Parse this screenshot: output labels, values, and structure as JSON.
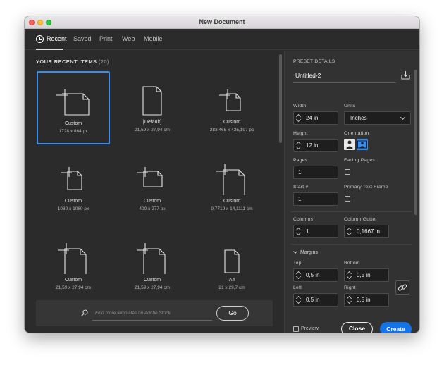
{
  "window": {
    "title": "New Document"
  },
  "tabs": [
    {
      "label": "Recent",
      "active": true
    },
    {
      "label": "Saved",
      "active": false
    },
    {
      "label": "Print",
      "active": false
    },
    {
      "label": "Web",
      "active": false
    },
    {
      "label": "Mobile",
      "active": false
    }
  ],
  "recent": {
    "heading": "YOUR RECENT ITEMS",
    "count": "(20)",
    "items": [
      {
        "name": "Custom",
        "dimensions": "1728 x 864 px",
        "selected": true,
        "icon": "custom-landscape-icon"
      },
      {
        "name": "[Default]",
        "dimensions": "21,59 x 27,94 cm",
        "selected": false,
        "icon": "portrait-page-icon"
      },
      {
        "name": "Custom",
        "dimensions": "283,465 x 425,197 pc",
        "selected": false,
        "icon": "custom-landscape-icon"
      },
      {
        "name": "Custom",
        "dimensions": "1080 x 1080 px",
        "selected": false,
        "icon": "custom-square-icon"
      },
      {
        "name": "Custom",
        "dimensions": "400 x 277 px",
        "selected": false,
        "icon": "custom-landscape-icon"
      },
      {
        "name": "Custom",
        "dimensions": "9,7719 x 14,1111 cm",
        "selected": false,
        "icon": "custom-portrait-icon"
      },
      {
        "name": "Custom",
        "dimensions": "21,59 x 27,94 cm",
        "selected": false,
        "icon": "custom-portrait-icon"
      },
      {
        "name": "Custom",
        "dimensions": "21,59 x 27,94 cm",
        "selected": false,
        "icon": "custom-portrait-icon"
      },
      {
        "name": "A4",
        "dimensions": "21 x 29,7 cm",
        "selected": false,
        "icon": "portrait-page-icon"
      }
    ]
  },
  "search": {
    "placeholder": "Find more templates on Adobe Stock",
    "go_label": "Go"
  },
  "preset": {
    "heading": "PRESET DETAILS",
    "document_name": "Untitled-2",
    "width_label": "Width",
    "width_value": "24 in",
    "units_label": "Units",
    "units_value": "Inches",
    "height_label": "Height",
    "height_value": "12 in",
    "orientation_label": "Orientation",
    "pages_label": "Pages",
    "pages_value": "1",
    "facing_pages_label": "Facing Pages",
    "start_label": "Start #",
    "start_value": "1",
    "primary_text_frame_label": "Primary Text Frame",
    "columns_label": "Columns",
    "columns_value": "1",
    "gutter_label": "Column Gutter",
    "gutter_value": "0,1667 in",
    "margins_label": "Margins",
    "top_label": "Top",
    "top_value": "0,5 in",
    "bottom_label": "Bottom",
    "bottom_value": "0,5 in",
    "left_label": "Left",
    "left_value": "0,5 in",
    "right_label": "Right",
    "right_value": "0,5 in",
    "preview_label": "Preview",
    "close_label": "Close",
    "create_label": "Create"
  },
  "colors": {
    "accent": "#378ef0",
    "create_button": "#1473e6",
    "panel_bg": "#2b2b2b",
    "settings_bg": "#323232"
  }
}
